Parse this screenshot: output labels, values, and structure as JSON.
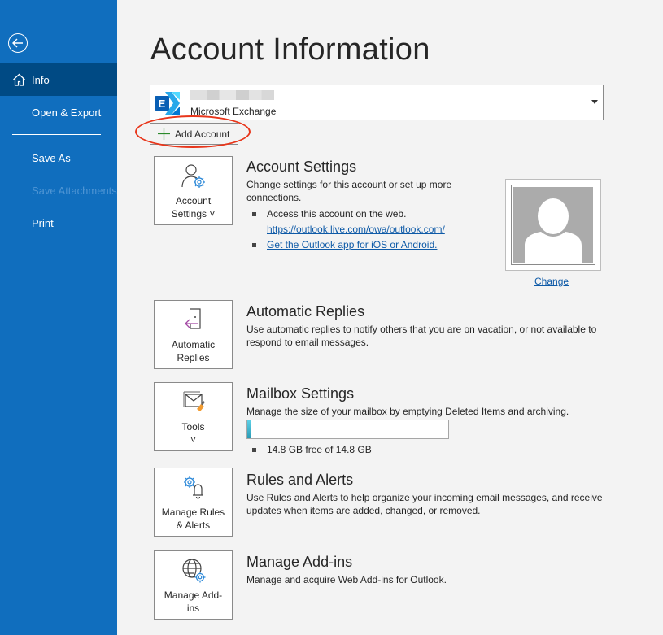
{
  "sidebar": {
    "back_label": "Back",
    "items": [
      {
        "label": "Info",
        "active": true
      },
      {
        "label": "Open & Export"
      },
      {
        "label": "Save As"
      },
      {
        "label": "Save Attachments",
        "disabled": true
      },
      {
        "label": "Print"
      }
    ]
  },
  "page_title": "Account Information",
  "account": {
    "email": "(redacted)",
    "type": "Microsoft Exchange",
    "add_account_label": "Add Account"
  },
  "sections": {
    "account_settings": {
      "tile_label_line1": "Account",
      "tile_label_line2": "Settings ˅",
      "title": "Account Settings",
      "description": "Change settings for this account or set up more connections.",
      "bullet1": "Access this account on the web.",
      "link1": "https://outlook.live.com/owa/outlook.com/",
      "link2": "Get the Outlook app for iOS or Android.",
      "change_label": "Change"
    },
    "automatic_replies": {
      "tile_label_line1": "Automatic",
      "tile_label_line2": "Replies",
      "title": "Automatic Replies",
      "description": "Use automatic replies to notify others that you are on vacation, or not available to respond to email messages."
    },
    "mailbox_settings": {
      "tile_label_line1": "Tools",
      "tile_label_line2": "˅",
      "title": "Mailbox Settings",
      "description": "Manage the size of your mailbox by emptying Deleted Items and archiving.",
      "quota_used_fraction": 0.01,
      "quota_text": "14.8 GB free of 14.8 GB"
    },
    "rules_alerts": {
      "tile_label_line1": "Manage Rules",
      "tile_label_line2": "& Alerts",
      "title": "Rules and Alerts",
      "description": "Use Rules and Alerts to help organize your incoming email messages, and receive updates when items are added, changed, or removed."
    },
    "addins": {
      "tile_label_line1": "Manage Add-",
      "tile_label_line2": "ins",
      "title": "Manage Add-ins",
      "description": "Manage and acquire Web Add-ins for Outlook."
    }
  },
  "colors": {
    "sidebar": "#106ebe",
    "sidebar_active": "#004a84",
    "link": "#0e5aa7",
    "highlight": "#e8361b"
  }
}
